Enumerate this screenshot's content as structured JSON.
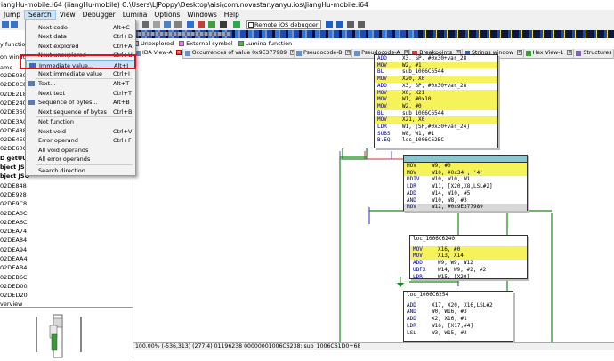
{
  "window": {
    "title": "iangHu-mobile.i64 (iiangHu-mobile) C:\\Users\\LJPoppy\\Desktop\\aisi\\com.novastar.yanyu.ios\\JiangHu-mobile.i64"
  },
  "menubar": [
    "Jump",
    "Search",
    "View",
    "Debugger",
    "Lumina",
    "Options",
    "Windows",
    "Help"
  ],
  "toolbar": {
    "debugger_select": "Remote iOS debugger"
  },
  "legend": [
    "Unexplored",
    "External symbol",
    "Lumina function"
  ],
  "legend_colors": [
    "#c0c8d0",
    "#ff70ff",
    "#40c040"
  ],
  "tabs": [
    "IDA View-A",
    "Occurrences of value 0x9E377989",
    "Pseudocode-B",
    "Pseudocode-A",
    "Breakpoints",
    "Strings window",
    "Hex View-1",
    "Structures"
  ],
  "left_panel": {
    "header1": "y functio",
    "header2": "on windo",
    "header3": "ame",
    "rows": [
      "02DE080",
      "02DE0C8",
      "02DE218",
      "02DE240",
      "02DE360",
      "02DE3A0",
      "02DE488",
      "02DE4E0",
      "02DE60C",
      "D getUUI",
      "bject JSO",
      "bject JSO",
      "02DE848",
      "02DE928",
      "02DE9C8",
      "02DEA0C",
      "02DEA6C",
      "02DEA74",
      "02DEA84",
      "02DEA94",
      "02DEAA4",
      "02DEAB4",
      "02DEB6C",
      "02DED00",
      "02DED20"
    ],
    "overview_label": "verview"
  },
  "search_menu": {
    "items": [
      {
        "label": "Next code",
        "shortcut": "Alt+C"
      },
      {
        "label": "Next data",
        "shortcut": "Ctrl+D"
      },
      {
        "label": "Next explored",
        "shortcut": "Ctrl+A"
      },
      {
        "label": "Next unexplored",
        "shortcut": "Ctrl+U"
      },
      {
        "label": "Immediate value...",
        "shortcut": "Alt+I"
      },
      {
        "label": "Next immediate value",
        "shortcut": "Ctrl+I"
      },
      {
        "label": "Text...",
        "shortcut": "Alt+T"
      },
      {
        "label": "Next text",
        "shortcut": "Ctrl+T"
      },
      {
        "label": "Sequence of bytes...",
        "shortcut": "Alt+B"
      },
      {
        "label": "Next sequence of bytes",
        "shortcut": "Ctrl+B"
      },
      {
        "label": "Not function",
        "shortcut": ""
      },
      {
        "label": "Next void",
        "shortcut": "Ctrl+V"
      },
      {
        "label": "Error operand",
        "shortcut": "Ctrl+F"
      },
      {
        "label": "All void operands",
        "shortcut": ""
      },
      {
        "label": "All error operands",
        "shortcut": ""
      },
      {
        "label": "Search direction",
        "shortcut": ""
      }
    ]
  },
  "graph": {
    "node1": [
      {
        "op": "ADD",
        "arg": "X3, SP, #0x30+var_28",
        "hl": false
      },
      {
        "op": "MOV",
        "arg": "W2, #1",
        "hl": true
      },
      {
        "op": "BL",
        "arg": "sub_1006C6544",
        "hl": false
      },
      {
        "op": "MOV",
        "arg": "X20, X0",
        "hl": true
      },
      {
        "op": "ADD",
        "arg": "X3, SP, #0x30+var_28",
        "hl": false
      },
      {
        "op": "MOV",
        "arg": "X0, X21",
        "hl": true
      },
      {
        "op": "MOV",
        "arg": "W1, #0x10",
        "hl": true
      },
      {
        "op": "MOV",
        "arg": "W2, #0",
        "hl": true
      },
      {
        "op": "BL",
        "arg": "sub_1006C6544",
        "hl": false
      },
      {
        "op": "MOV",
        "arg": "X21, X0",
        "hl": true
      },
      {
        "op": "LDR",
        "arg": "W1, [SP,#0x30+var_24]",
        "hl": false
      },
      {
        "op": "SUBS",
        "arg": "W8, W1, #1",
        "hl": false
      },
      {
        "op": "B.EQ",
        "arg": "loc_1006C62EC",
        "hl": false
      }
    ],
    "node2": [
      {
        "op": "MOV",
        "arg": "W9, #0",
        "hl": true
      },
      {
        "op": "MOV",
        "arg": "W10, #0x34 ; '4'",
        "hl": true
      },
      {
        "op": "UDIV",
        "arg": "W10, W10, W1",
        "hl": false
      },
      {
        "op": "LDR",
        "arg": "W11, [X20,X8,LSL#2]",
        "hl": false
      },
      {
        "op": "ADD",
        "arg": "W14, W10, #5",
        "hl": false
      },
      {
        "op": "AND",
        "arg": "W10, W8, #3",
        "hl": false
      },
      {
        "op": "MOV",
        "arg": "W12, #0x9E377989",
        "hl": true
      }
    ],
    "node3_label": "loc_1006C6240",
    "node3": [
      {
        "op": "MOV",
        "arg": "X16, #0",
        "hl": true
      },
      {
        "op": "MOV",
        "arg": "X13, X14",
        "hl": true
      },
      {
        "op": "ADD",
        "arg": "W9, W9, W12",
        "hl": false
      },
      {
        "op": "UBFX",
        "arg": "W14, W9, #2, #2",
        "hl": false
      },
      {
        "op": "LDR",
        "arg": "W15, [X20]",
        "hl": false
      }
    ],
    "node4_label": "loc_1006C6254",
    "node4": [
      {
        "op": "ADD",
        "arg": "X17, X20, X16,LSL#2",
        "hl": false
      },
      {
        "op": "AND",
        "arg": "W0, W16, #3",
        "hl": false
      },
      {
        "op": "ADD",
        "arg": "X2, X16, #1",
        "hl": false
      },
      {
        "op": "LDR",
        "arg": "W16, [X17,#4]",
        "hl": false
      },
      {
        "op": "LSL",
        "arg": "W3, W15, #2",
        "hl": false
      }
    ]
  },
  "status_bar": "100.00% (-536,313) (277,4) 01196238 00000001006C6238: sub_1006C61D0+68"
}
